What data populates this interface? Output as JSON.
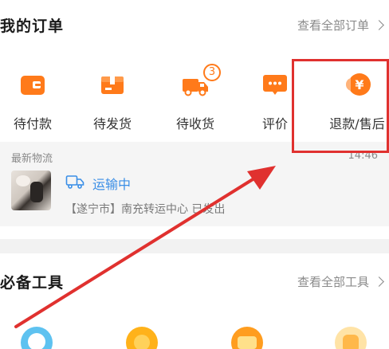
{
  "orders": {
    "title": "我的订单",
    "view_all": "查看全部订单",
    "items": [
      {
        "label": "待付款",
        "icon": "wallet-icon"
      },
      {
        "label": "待发货",
        "icon": "package-icon"
      },
      {
        "label": "待收货",
        "icon": "delivery-truck-icon",
        "badge": "3"
      },
      {
        "label": "评价",
        "icon": "comment-icon"
      },
      {
        "label": "退款/售后",
        "icon": "refund-yen-icon"
      }
    ],
    "logistics": {
      "title": "最新物流",
      "time": "14:46",
      "status": "运输中",
      "detail": "【遂宁市】南充转运中心 已发出"
    }
  },
  "tools": {
    "title": "必备工具",
    "view_all": "查看全部工具"
  },
  "colors": {
    "accent_orange": "#ff7a1a",
    "status_blue": "#3a8ee6",
    "annotation_red": "#e0312f"
  }
}
